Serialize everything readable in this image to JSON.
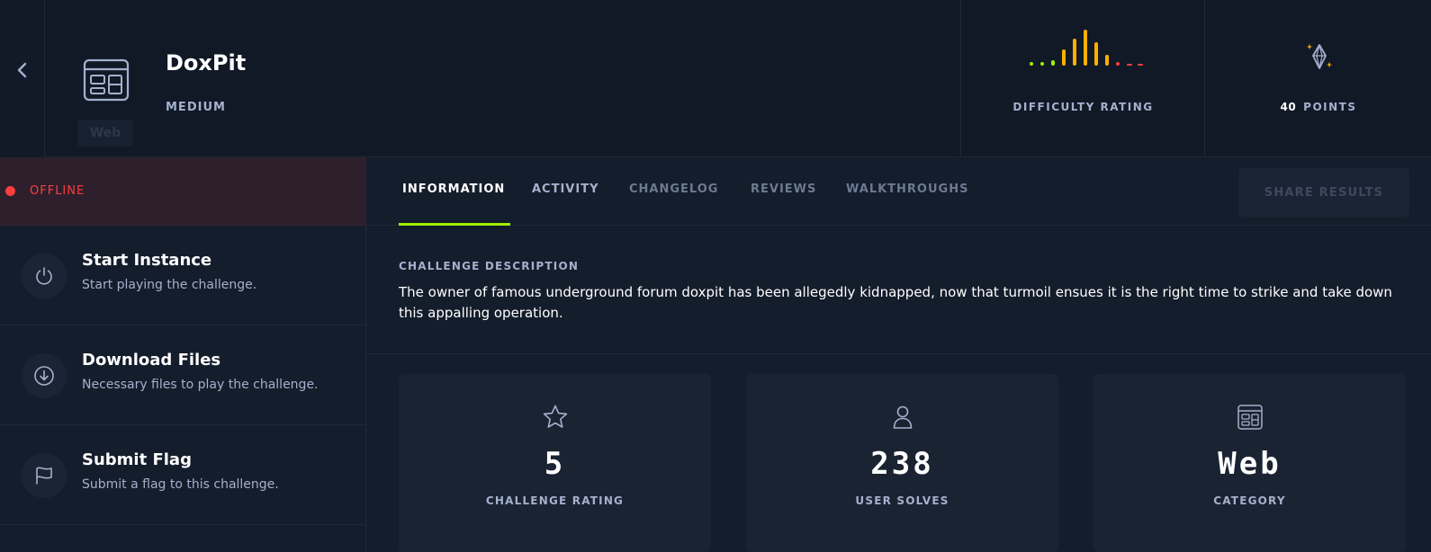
{
  "header": {
    "back_icon": "chevron-left-icon",
    "category_icon": "web-browser-icon",
    "category_tag": "Web",
    "title": "DoxPit",
    "difficulty": "MEDIUM",
    "difficulty_rating_label": "DIFFICULTY RATING",
    "difficulty_bars": [
      {
        "level": 0.1,
        "color": "#9fef00"
      },
      {
        "level": 0.1,
        "color": "#9fef00"
      },
      {
        "level": 0.15,
        "color": "#9fef00"
      },
      {
        "level": 0.45,
        "color": "#ffaf00"
      },
      {
        "level": 0.75,
        "color": "#ffaf00"
      },
      {
        "level": 1.0,
        "color": "#ffaf00"
      },
      {
        "level": 0.65,
        "color": "#ffaf00"
      },
      {
        "level": 0.3,
        "color": "#ffaf00"
      },
      {
        "level": 0.1,
        "color": "#ff3e3e"
      },
      {
        "level": 0.04,
        "color": "#ff3e3e"
      },
      {
        "level": 0.04,
        "color": "#ff3e3e"
      }
    ],
    "points_icon": "diamond-gem-icon",
    "points_value": "40",
    "points_label": "POINTS"
  },
  "sidebar": {
    "status": "OFFLINE",
    "status_color": "#ff3e3e",
    "actions": [
      {
        "icon": "power-icon",
        "title": "Start Instance",
        "subtitle": "Start playing the challenge."
      },
      {
        "icon": "download-icon",
        "title": "Download Files",
        "subtitle": "Necessary files to play the challenge."
      },
      {
        "icon": "flag-icon",
        "title": "Submit Flag",
        "subtitle": "Submit a flag to this challenge."
      }
    ]
  },
  "tabs": [
    {
      "label": "INFORMATION",
      "active": true
    },
    {
      "label": "ACTIVITY"
    },
    {
      "label": "CHANGELOG"
    },
    {
      "label": "REVIEWS"
    },
    {
      "label": "WALKTHROUGHS"
    }
  ],
  "share_button": "SHARE RESULTS",
  "description": {
    "label": "CHALLENGE DESCRIPTION",
    "text": "The owner of famous underground forum doxpit has been allegedly kidnapped, now that turmoil ensues it is the right time to strike and take down this appalling operation."
  },
  "stats": [
    {
      "icon": "star-icon",
      "value": "5",
      "label": "CHALLENGE RATING"
    },
    {
      "icon": "user-icon",
      "value": "238",
      "label": "USER SOLVES"
    },
    {
      "icon": "web-browser-icon",
      "value": "Web",
      "label": "CATEGORY"
    }
  ],
  "colors": {
    "accent": "#9fef00",
    "background": "#141d2b",
    "muted_text": "#a4b1cd"
  }
}
